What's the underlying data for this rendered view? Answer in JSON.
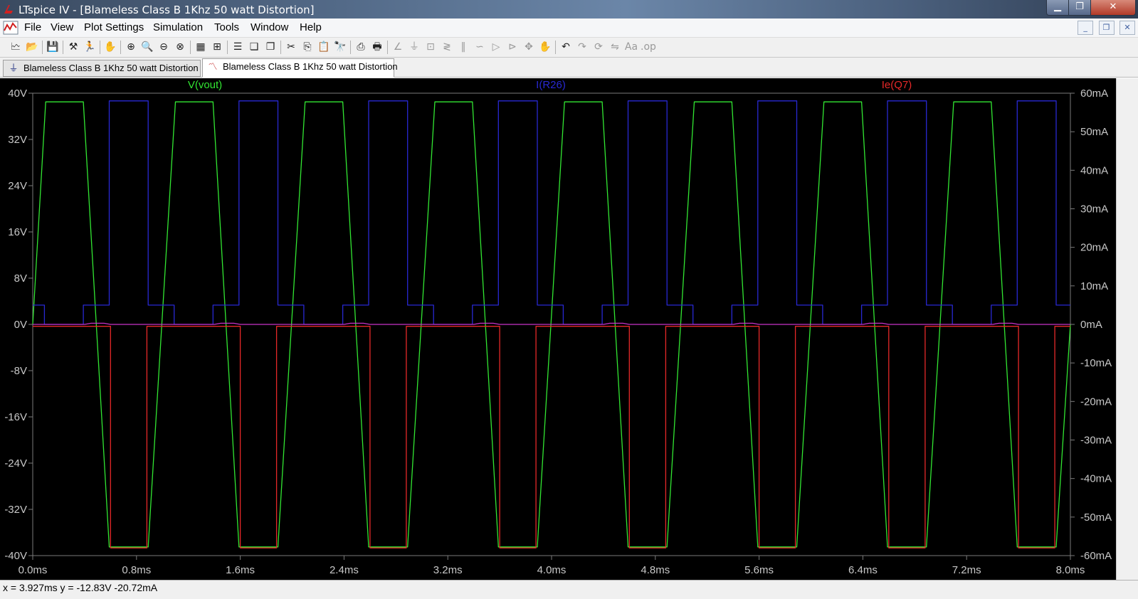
{
  "window": {
    "title": "LTspice IV - [Blameless Class B 1Khz 50 watt Distortion]",
    "minimize": "▁",
    "maximize": "❐",
    "close": "✕"
  },
  "menu": [
    "File",
    "View",
    "Plot Settings",
    "Simulation",
    "Tools",
    "Window",
    "Help"
  ],
  "mdi": {
    "minimize": "_",
    "restore": "❐",
    "close": "✕"
  },
  "toolbar": [
    {
      "icon": "new-plot-icon",
      "glyph": "🗠",
      "dim": false
    },
    {
      "icon": "open-icon",
      "glyph": "📂",
      "dim": false
    },
    {
      "icon": "save-icon",
      "glyph": "💾",
      "dim": false
    },
    {
      "icon": "control-panel-icon",
      "glyph": "⚒",
      "dim": false
    },
    {
      "icon": "run-icon",
      "glyph": "🏃",
      "dim": false
    },
    {
      "icon": "halt-icon",
      "glyph": "✋",
      "dim": true
    },
    {
      "icon": "zoom-in-icon",
      "glyph": "⊕",
      "dim": false
    },
    {
      "icon": "zoom-area-icon",
      "glyph": "🔍",
      "dim": false
    },
    {
      "icon": "zoom-out-icon",
      "glyph": "⊖",
      "dim": false
    },
    {
      "icon": "zoom-cancel-icon",
      "glyph": "⊗",
      "dim": false
    },
    {
      "icon": "autorange-icon",
      "glyph": "▦",
      "dim": false
    },
    {
      "icon": "add-trace-icon",
      "glyph": "⊞",
      "dim": false
    },
    {
      "icon": "tile-horizontal-icon",
      "glyph": "☰",
      "dim": false
    },
    {
      "icon": "cascade-icon",
      "glyph": "❏",
      "dim": false
    },
    {
      "icon": "tile-vertical-icon",
      "glyph": "❐",
      "dim": false
    },
    {
      "icon": "cut-icon",
      "glyph": "✂",
      "dim": false
    },
    {
      "icon": "copy-icon",
      "glyph": "⎘",
      "dim": false
    },
    {
      "icon": "paste-icon",
      "glyph": "📋",
      "dim": true
    },
    {
      "icon": "find-icon",
      "glyph": "🔭",
      "dim": false
    },
    {
      "icon": "print-icon",
      "glyph": "⎙",
      "dim": false
    },
    {
      "icon": "print-setup-icon",
      "glyph": "🖶",
      "dim": false
    },
    {
      "icon": "wire-icon",
      "glyph": "∠",
      "dim": true
    },
    {
      "icon": "ground-icon",
      "glyph": "⏚",
      "dim": true
    },
    {
      "icon": "label-net-icon",
      "glyph": "⊡",
      "dim": true
    },
    {
      "icon": "resistor-icon",
      "glyph": "≷",
      "dim": true
    },
    {
      "icon": "capacitor-icon",
      "glyph": "‖",
      "dim": true
    },
    {
      "icon": "inductor-icon",
      "glyph": "∽",
      "dim": true
    },
    {
      "icon": "diode-icon",
      "glyph": "▷",
      "dim": true
    },
    {
      "icon": "component-icon",
      "glyph": "⊳",
      "dim": true
    },
    {
      "icon": "move-icon",
      "glyph": "✥",
      "dim": true
    },
    {
      "icon": "drag-icon",
      "glyph": "✋",
      "dim": true
    },
    {
      "icon": "undo-icon",
      "glyph": "↶",
      "dim": false
    },
    {
      "icon": "redo-icon",
      "glyph": "↷",
      "dim": true
    },
    {
      "icon": "rotate-icon",
      "glyph": "⟳",
      "dim": true
    },
    {
      "icon": "mirror-icon",
      "glyph": "⇋",
      "dim": true
    },
    {
      "icon": "text-icon",
      "glyph": "Aa",
      "dim": true
    },
    {
      "icon": "spice-directive-icon",
      "glyph": ".op",
      "dim": true
    }
  ],
  "tabs": [
    {
      "label": "Blameless Class B 1Khz 50 watt Distortion",
      "kind": "schematic",
      "active": false
    },
    {
      "label": "Blameless Class B 1Khz 50 watt Distortion",
      "kind": "plot",
      "active": true
    }
  ],
  "colors": {
    "vout": "#32e632",
    "ir26": "#2828d2",
    "ie_q7": "#e62828",
    "grid": "#7a7a7a",
    "background": "#000000"
  },
  "chart_data": {
    "type": "line",
    "title": "",
    "xlabel": "",
    "ylabel_left": "",
    "ylabel_right": "",
    "xlim": [
      0,
      8
    ],
    "x_unit": "ms",
    "ylim_left": [
      -40,
      40
    ],
    "ylim_right": [
      -60,
      60
    ],
    "x_ticks": [
      "0.0ms",
      "0.8ms",
      "1.6ms",
      "2.4ms",
      "3.2ms",
      "4.0ms",
      "4.8ms",
      "5.6ms",
      "6.4ms",
      "7.2ms",
      "8.0ms"
    ],
    "y_ticks_left": [
      "40V",
      "32V",
      "24V",
      "16V",
      "8V",
      "0V",
      "-8V",
      "-16V",
      "-24V",
      "-32V",
      "-40V"
    ],
    "y_ticks_right": [
      "60mA",
      "50mA",
      "40mA",
      "30mA",
      "20mA",
      "10mA",
      "0mA",
      "-10mA",
      "-20mA",
      "-30mA",
      "-40mA",
      "-50mA",
      "-60mA"
    ],
    "grid": "off",
    "series": [
      {
        "name": "V(vout)",
        "axis": "left",
        "unit": "V",
        "points": [
          [
            0,
            0
          ],
          [
            0.1,
            38.5
          ],
          [
            0.39,
            38.5
          ],
          [
            0.59,
            -38.5
          ],
          [
            0.89,
            -38.5
          ],
          [
            1.1,
            38.5
          ],
          [
            1.39,
            38.5
          ],
          [
            1.59,
            -38.5
          ],
          [
            1.89,
            -38.5
          ],
          [
            2.1,
            38.5
          ],
          [
            2.39,
            38.5
          ],
          [
            2.59,
            -38.5
          ],
          [
            2.89,
            -38.5
          ],
          [
            3.1,
            38.5
          ],
          [
            3.39,
            38.5
          ],
          [
            3.59,
            -38.5
          ],
          [
            3.89,
            -38.5
          ],
          [
            4.1,
            38.5
          ],
          [
            4.39,
            38.5
          ],
          [
            4.59,
            -38.5
          ],
          [
            4.89,
            -38.5
          ],
          [
            5.1,
            38.5
          ],
          [
            5.39,
            38.5
          ],
          [
            5.59,
            -38.5
          ],
          [
            5.89,
            -38.5
          ],
          [
            6.1,
            38.5
          ],
          [
            6.39,
            38.5
          ],
          [
            6.59,
            -38.5
          ],
          [
            6.89,
            -38.5
          ],
          [
            7.1,
            38.5
          ],
          [
            7.39,
            38.5
          ],
          [
            7.59,
            -38.5
          ],
          [
            7.89,
            -38.5
          ],
          [
            8.0,
            0
          ]
        ]
      },
      {
        "name": "I(R26)",
        "axis": "right",
        "unit": "mA",
        "points": [
          [
            0,
            5
          ],
          [
            0.09,
            5
          ],
          [
            0.09,
            0
          ],
          [
            0.39,
            0
          ],
          [
            0.39,
            5
          ],
          [
            0.59,
            5
          ],
          [
            0.59,
            58
          ],
          [
            0.89,
            58
          ],
          [
            0.89,
            5
          ],
          [
            1.09,
            5
          ],
          [
            1.09,
            0
          ],
          [
            1.39,
            0
          ],
          [
            1.39,
            5
          ],
          [
            1.59,
            5
          ],
          [
            1.59,
            58
          ],
          [
            1.89,
            58
          ],
          [
            1.89,
            5
          ],
          [
            2.09,
            5
          ],
          [
            2.09,
            0
          ],
          [
            2.39,
            0
          ],
          [
            2.39,
            5
          ],
          [
            2.59,
            5
          ],
          [
            2.59,
            58
          ],
          [
            2.89,
            58
          ],
          [
            2.89,
            5
          ],
          [
            3.09,
            5
          ],
          [
            3.09,
            0
          ],
          [
            3.39,
            0
          ],
          [
            3.39,
            5
          ],
          [
            3.59,
            5
          ],
          [
            3.59,
            58
          ],
          [
            3.89,
            58
          ],
          [
            3.89,
            5
          ],
          [
            4.09,
            5
          ],
          [
            4.09,
            0
          ],
          [
            4.39,
            0
          ],
          [
            4.39,
            5
          ],
          [
            4.59,
            5
          ],
          [
            4.59,
            58
          ],
          [
            4.89,
            58
          ],
          [
            4.89,
            5
          ],
          [
            5.09,
            5
          ],
          [
            5.09,
            0
          ],
          [
            5.39,
            0
          ],
          [
            5.39,
            5
          ],
          [
            5.59,
            5
          ],
          [
            5.59,
            58
          ],
          [
            5.89,
            58
          ],
          [
            5.89,
            5
          ],
          [
            6.09,
            5
          ],
          [
            6.09,
            0
          ],
          [
            6.39,
            0
          ],
          [
            6.39,
            5
          ],
          [
            6.59,
            5
          ],
          [
            6.59,
            58
          ],
          [
            6.89,
            58
          ],
          [
            6.89,
            5
          ],
          [
            7.09,
            5
          ],
          [
            7.09,
            0
          ],
          [
            7.39,
            0
          ],
          [
            7.39,
            5
          ],
          [
            7.59,
            5
          ],
          [
            7.59,
            58
          ],
          [
            7.89,
            58
          ],
          [
            7.89,
            5
          ],
          [
            8.0,
            5
          ]
        ]
      },
      {
        "name": "Ie(Q7)",
        "axis": "right",
        "unit": "mA",
        "points": [
          [
            0,
            -0.5
          ],
          [
            0.6,
            -0.5
          ],
          [
            0.6,
            -58
          ],
          [
            0.88,
            -58
          ],
          [
            0.88,
            -0.5
          ],
          [
            1.6,
            -0.5
          ],
          [
            1.6,
            -58
          ],
          [
            1.88,
            -58
          ],
          [
            1.88,
            -0.5
          ],
          [
            2.6,
            -0.5
          ],
          [
            2.6,
            -58
          ],
          [
            2.88,
            -58
          ],
          [
            2.88,
            -0.5
          ],
          [
            3.6,
            -0.5
          ],
          [
            3.6,
            -58
          ],
          [
            3.88,
            -58
          ],
          [
            3.88,
            -0.5
          ],
          [
            4.6,
            -0.5
          ],
          [
            4.6,
            -58
          ],
          [
            4.88,
            -58
          ],
          [
            4.88,
            -0.5
          ],
          [
            5.6,
            -0.5
          ],
          [
            5.6,
            -58
          ],
          [
            5.88,
            -58
          ],
          [
            5.88,
            -0.5
          ],
          [
            6.6,
            -0.5
          ],
          [
            6.6,
            -58
          ],
          [
            6.88,
            -58
          ],
          [
            6.88,
            -0.5
          ],
          [
            7.6,
            -0.5
          ],
          [
            7.6,
            -58
          ],
          [
            7.88,
            -58
          ],
          [
            7.88,
            -0.5
          ],
          [
            8.0,
            -0.5
          ]
        ]
      },
      {
        "name": "",
        "axis": "right",
        "unit": "mA",
        "points": [
          [
            0,
            0
          ],
          [
            0.4,
            0
          ],
          [
            0.45,
            0.3
          ],
          [
            0.55,
            0.3
          ],
          [
            0.6,
            0
          ],
          [
            1.4,
            0
          ],
          [
            1.45,
            0.3
          ],
          [
            1.55,
            0.3
          ],
          [
            1.6,
            0
          ],
          [
            2.4,
            0
          ],
          [
            2.45,
            0.3
          ],
          [
            2.55,
            0.3
          ],
          [
            2.6,
            0
          ],
          [
            3.4,
            0
          ],
          [
            3.45,
            0.3
          ],
          [
            3.55,
            0.3
          ],
          [
            3.6,
            0
          ],
          [
            4.4,
            0
          ],
          [
            4.45,
            0.3
          ],
          [
            4.55,
            0.3
          ],
          [
            4.6,
            0
          ],
          [
            5.4,
            0
          ],
          [
            5.45,
            0.3
          ],
          [
            5.55,
            0.3
          ],
          [
            5.6,
            0
          ],
          [
            6.4,
            0
          ],
          [
            6.45,
            0.3
          ],
          [
            6.55,
            0.3
          ],
          [
            6.6,
            0
          ],
          [
            7.4,
            0
          ],
          [
            7.45,
            0.3
          ],
          [
            7.55,
            0.3
          ],
          [
            7.6,
            0
          ],
          [
            8.0,
            0
          ]
        ]
      }
    ]
  },
  "status": "x = 3.927ms   y = -12.83V  -20.72mA"
}
